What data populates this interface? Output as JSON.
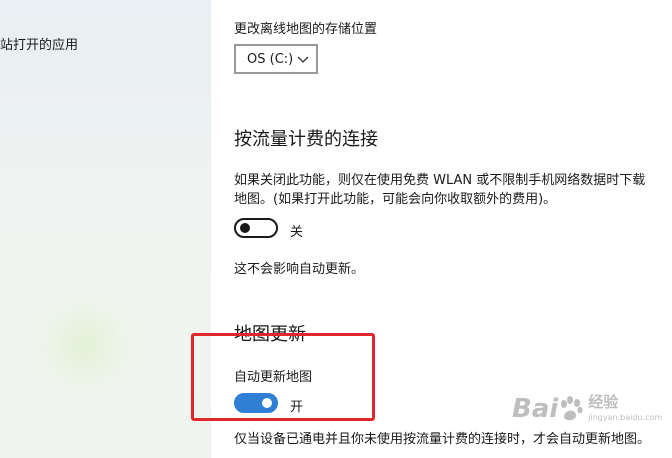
{
  "sidebar": {
    "item_label": "站打开的应用"
  },
  "storage": {
    "label": "更改离线地图的存储位置",
    "dropdown_value": "OS (C:)"
  },
  "metered": {
    "heading": "按流量计费的连接",
    "description_line1": "如果关闭此功能，则仅在使用免费 WLAN 或不限制手机网络数据时下载",
    "description_line2": "地图。(如果打开此功能，可能会向你收取额外的费用)。",
    "toggle_checked": false,
    "toggle_state": "关",
    "note": "这不会影响自动更新。"
  },
  "updates": {
    "heading": "地图更新",
    "auto_update_label": "自动更新地图",
    "toggle_checked": true,
    "toggle_state": "开",
    "footer_text": "仅当设备已通电并且你未使用按流量计费的连接时，才会自动更新地图。"
  },
  "colors": {
    "toggle_on": "#2f7fd4",
    "highlight": "#e0282c"
  },
  "watermark": {
    "brand_left": "Bai",
    "brand_right": "经验",
    "url": "jingyan.baidu.com"
  }
}
